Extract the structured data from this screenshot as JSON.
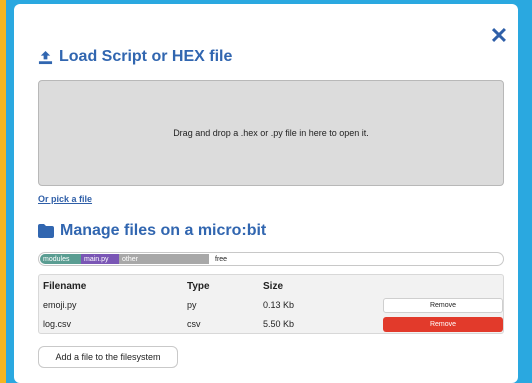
{
  "dialog": {
    "close_icon": "close-icon",
    "title": "Load Script or HEX file",
    "title_icon": "upload-icon",
    "dropzone_text": "Drag and drop a .hex or .py file in here to open it.",
    "pick_link": "Or pick a file",
    "manage_title": "Manage files on a micro:bit",
    "manage_icon": "folder-icon"
  },
  "storage": {
    "segments": [
      {
        "label": "modules",
        "color": "#5a9d92"
      },
      {
        "label": "main.py",
        "color": "#7a56b5"
      },
      {
        "label": "other",
        "color": "#a8a8a8"
      },
      {
        "label": "free",
        "color": "#ffffff"
      }
    ]
  },
  "files": {
    "headers": [
      "Filename",
      "Type",
      "Size"
    ],
    "rows": [
      {
        "name": "emoji.py",
        "type": "py",
        "size": "0.13 Kb",
        "action": "Remove"
      },
      {
        "name": "log.csv",
        "type": "csv",
        "size": "5.50 Kb",
        "action": "Remove"
      }
    ]
  },
  "add_button": "Add a file to the filesystem",
  "colors": {
    "accent": "#3166b0",
    "danger": "#e23a2b",
    "page_bg": "#2aa8e0"
  }
}
